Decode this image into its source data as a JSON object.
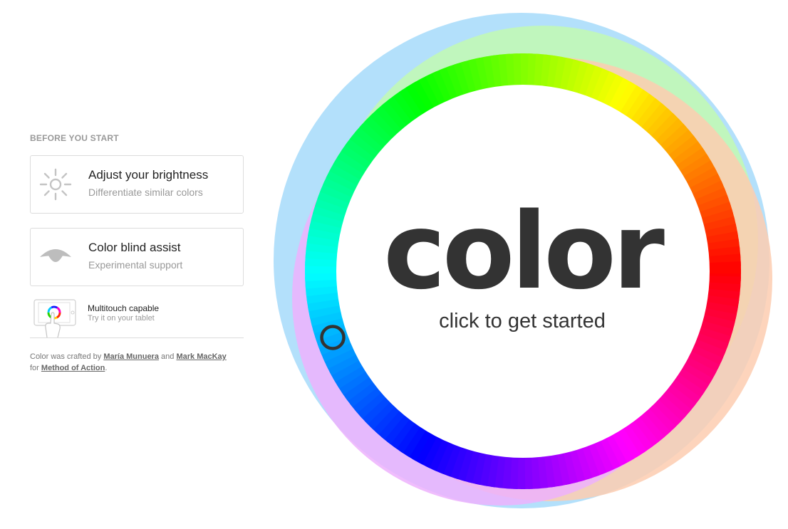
{
  "sidebar": {
    "section_title": "BEFORE YOU START",
    "brightness": {
      "icon": "sun-icon",
      "title": "Adjust your brightness",
      "subtitle": "Differentiate similar colors"
    },
    "color_blind": {
      "icon": "eye-icon",
      "title": "Color blind assist",
      "subtitle": "Experimental support"
    },
    "multitouch": {
      "icon": "tablet-touch-icon",
      "title": "Multitouch capable",
      "subtitle": "Try it on your tablet"
    },
    "credits": {
      "prefix": "Color was crafted by",
      "author1": "María Munuera",
      "and": "and",
      "author2": "Mark MacKay",
      "for": "for",
      "org": "Method of Action",
      "suffix": "."
    }
  },
  "wheel": {
    "logo": "color",
    "prompt": "click to get started",
    "overlay_colors": [
      "#b3e0fb",
      "#c2f9b2",
      "#fdcdb0",
      "#edb1fd"
    ],
    "picker_color": "#333333"
  }
}
